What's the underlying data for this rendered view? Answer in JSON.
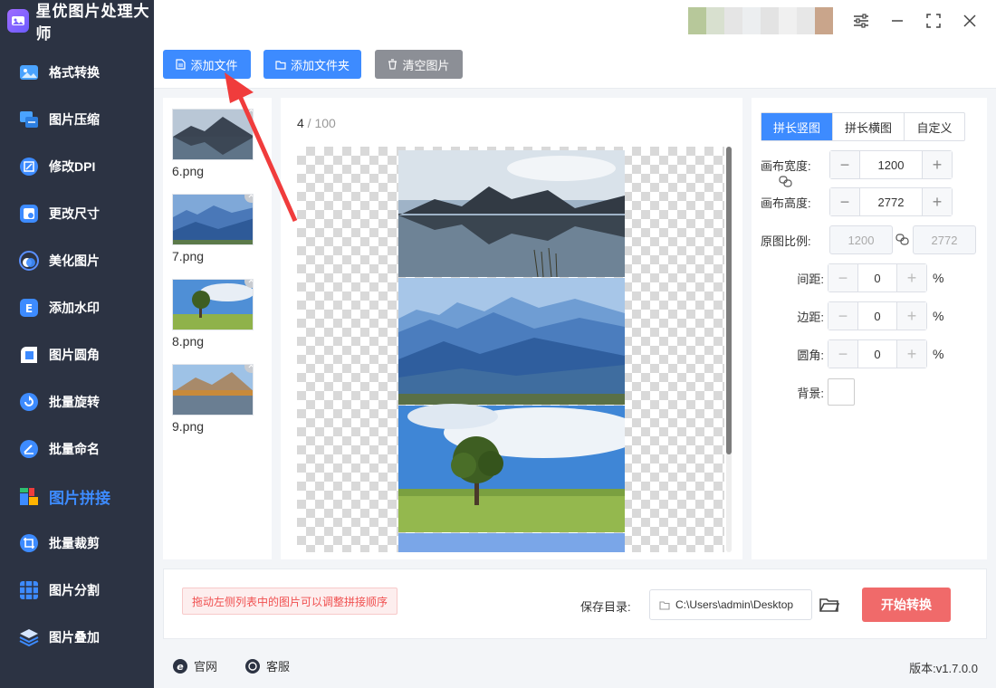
{
  "app": {
    "title": "星优图片处理大师"
  },
  "sidebar": {
    "items": [
      {
        "label": "格式转换",
        "icon": "image-convert-icon",
        "active": false
      },
      {
        "label": "图片压缩",
        "icon": "image-compress-icon",
        "active": false
      },
      {
        "label": "修改DPI",
        "icon": "dpi-icon",
        "active": false
      },
      {
        "label": "更改尺寸",
        "icon": "resize-icon",
        "active": false
      },
      {
        "label": "美化图片",
        "icon": "beautify-icon",
        "active": false
      },
      {
        "label": "添加水印",
        "icon": "watermark-icon",
        "active": false
      },
      {
        "label": "图片圆角",
        "icon": "rounded-corner-icon",
        "active": false
      },
      {
        "label": "批量旋转",
        "icon": "rotate-icon",
        "active": false
      },
      {
        "label": "批量命名",
        "icon": "rename-icon",
        "active": false
      },
      {
        "label": "图片拼接",
        "icon": "stitch-icon",
        "active": true
      },
      {
        "label": "批量裁剪",
        "icon": "crop-icon",
        "active": false
      },
      {
        "label": "图片分割",
        "icon": "split-icon",
        "active": false
      },
      {
        "label": "图片叠加",
        "icon": "layers-icon",
        "active": false
      }
    ]
  },
  "toolbar": {
    "add_file": "添加文件",
    "add_folder": "添加文件夹",
    "clear": "清空图片"
  },
  "files": [
    {
      "name": "6.png",
      "thumb": "lake-mountain"
    },
    {
      "name": "7.png",
      "thumb": "blue-mountains"
    },
    {
      "name": "8.png",
      "thumb": "tree-field"
    },
    {
      "name": "9.png",
      "thumb": "autumn-lake"
    }
  ],
  "preview": {
    "current": "4",
    "total": "100"
  },
  "settings": {
    "tabs": [
      "拼长竖图",
      "拼长横图",
      "自定义"
    ],
    "active_tab": 0,
    "canvas_width_label": "画布宽度:",
    "canvas_width": "1200",
    "canvas_height_label": "画布高度:",
    "canvas_height": "2772",
    "orig_ratio_label": "原图比例:",
    "orig_w": "1200",
    "orig_h": "2772",
    "spacing_label": "间距:",
    "spacing": "0",
    "margin_label": "边距:",
    "margin": "0",
    "radius_label": "圆角:",
    "radius": "0",
    "percent": "%",
    "background_label": "背景:"
  },
  "bottom": {
    "hint": "拖动左侧列表中的图片可以调整拼接顺序",
    "save_label": "保存目录:",
    "save_path": "C:\\Users\\admin\\Desktop",
    "start": "开始转换"
  },
  "footer": {
    "website": "官网",
    "support": "客服",
    "version": "版本:v1.7.0.0"
  },
  "colors": {
    "accent": "#3d8bff",
    "sidebar_bg": "#2c3343",
    "start_btn": "#f06a6a",
    "clear_btn": "#8c8f96",
    "arrow": "#f03c3c"
  }
}
